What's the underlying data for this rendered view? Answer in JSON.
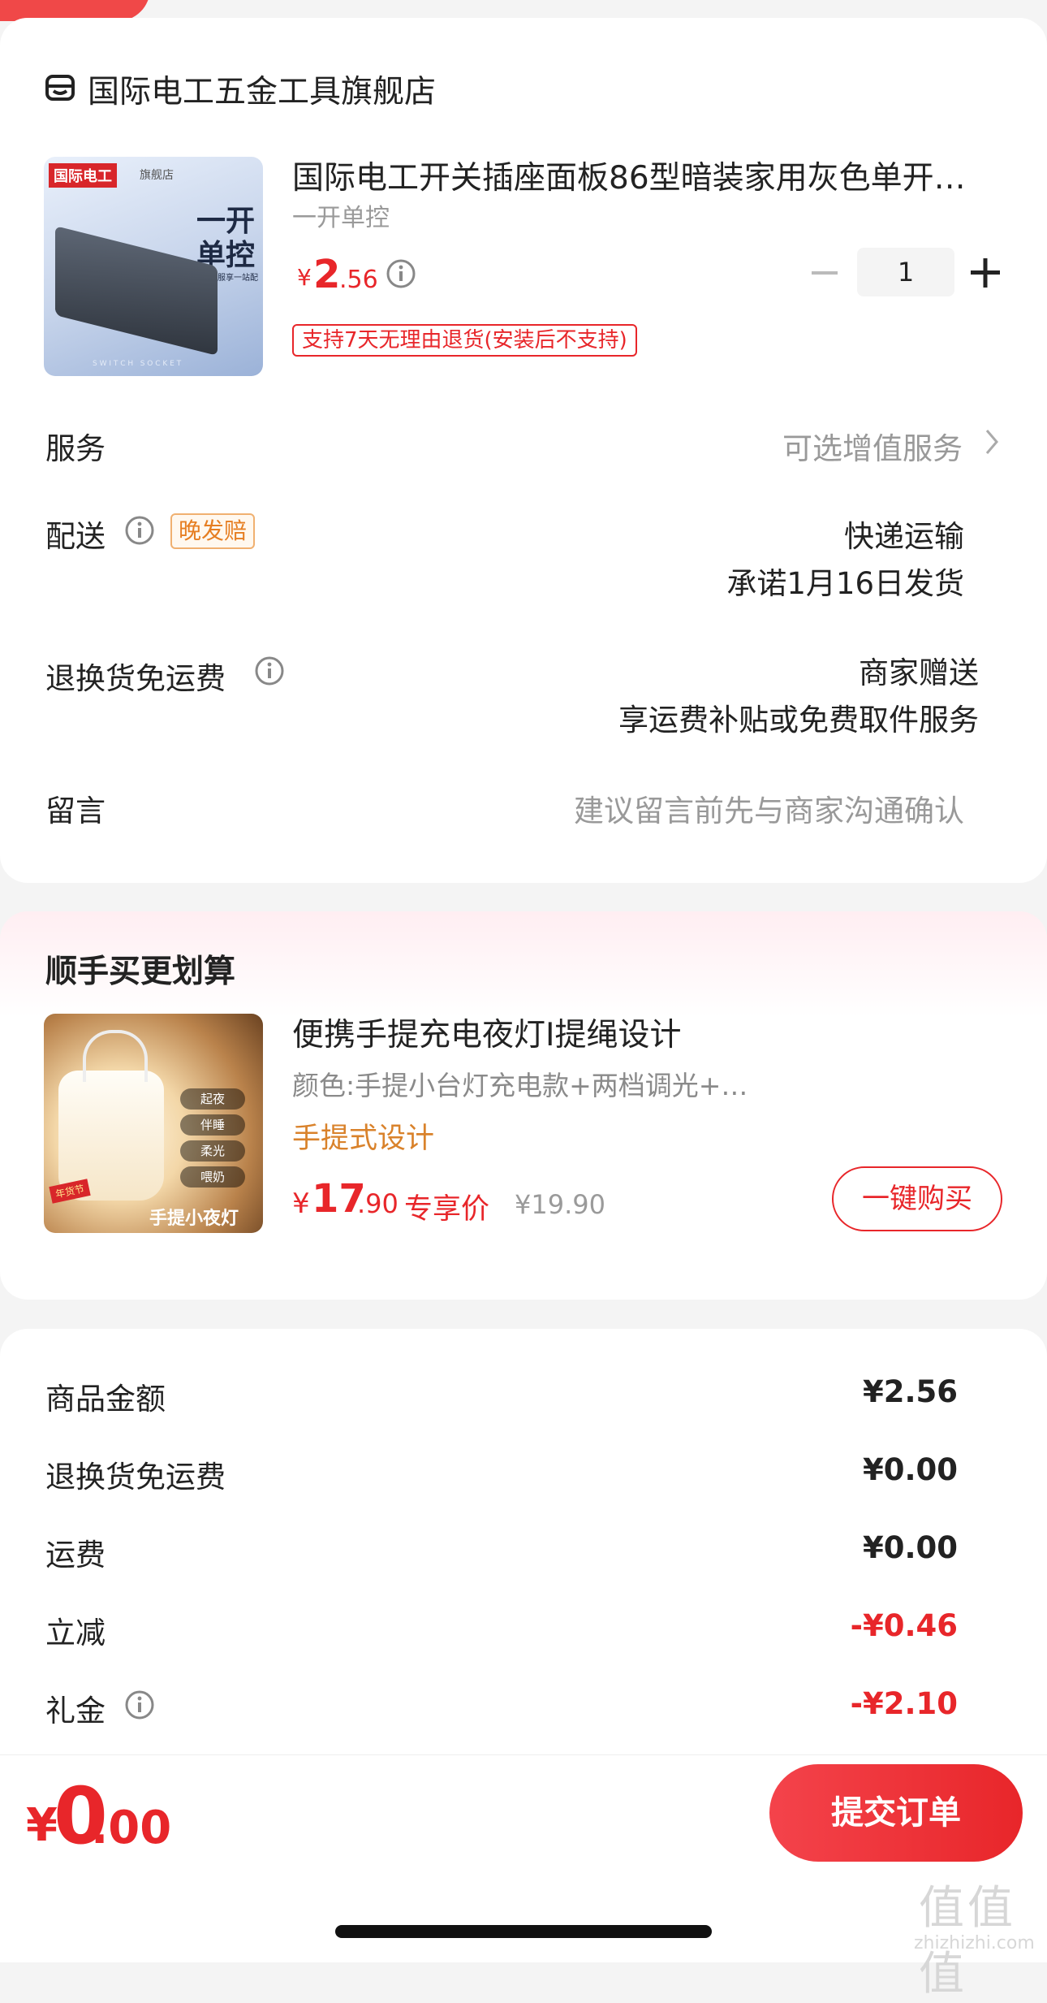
{
  "store": {
    "icon": "store-icon",
    "name": "国际电工五金工具旗舰店"
  },
  "product": {
    "image_brand": "国际电工",
    "image_badge": "旗舰店",
    "image_line1": "一开",
    "image_line2": "单控",
    "image_note": "联系客服享一站配齐",
    "image_footer": "S W I T C H   S O C K E T",
    "title": "国际电工开关插座面板86型暗装家用灰色单开…",
    "variant": "一开单控",
    "price_symbol": "¥",
    "price_int": "2",
    "price_dec": ".56",
    "quantity": "1",
    "return_policy": "支持7天无理由退货(安装后不支持)"
  },
  "rows": {
    "service_label": "服务",
    "service_value": "可选增值服务",
    "delivery_label": "配送",
    "delivery_tag": "晚发赔",
    "delivery_method": "快递运输",
    "delivery_promise": "承诺1月16日发货",
    "freight_label": "退换货免运费",
    "freight_value1": "商家赠送",
    "freight_value2": "享运费补贴或免费取件服务",
    "message_label": "留言",
    "message_placeholder": "建议留言前先与商家沟通确认"
  },
  "upsell": {
    "section_title": "顺手买更划算",
    "title": "便携手提充电夜灯I提绳设计",
    "subtitle": "颜色:手提小台灯充电款+两档调光+…",
    "tag": "手提式设计",
    "price_symbol": "¥",
    "price_int": "17",
    "price_dec": ".90",
    "exclusive_label": "专享价",
    "original_price": "¥19.90",
    "buy_button": "一键购买",
    "image_modes": [
      "起夜",
      "伴睡",
      "柔光",
      "喂奶"
    ],
    "image_caption": "手提小夜灯",
    "image_badge": "年货节"
  },
  "summary": [
    {
      "label": "商品金额",
      "value": "¥2.56"
    },
    {
      "label": "退换货免运费",
      "value": "¥0.00"
    },
    {
      "label": "运费",
      "value": "¥0.00"
    },
    {
      "label": "立减",
      "value": "-¥0.46"
    },
    {
      "label": "礼金",
      "value": "-¥2.10"
    }
  ],
  "footer": {
    "total_symbol": "¥",
    "total_int": "0",
    "total_dec": ".00",
    "submit_button": "提交订单",
    "watermark": "值值值",
    "watermark_url": "zhizhizhi.com"
  },
  "colors": {
    "accent": "#e8262a",
    "orange": "#d9822b",
    "muted": "#999999",
    "background": "#f4f4f4"
  }
}
